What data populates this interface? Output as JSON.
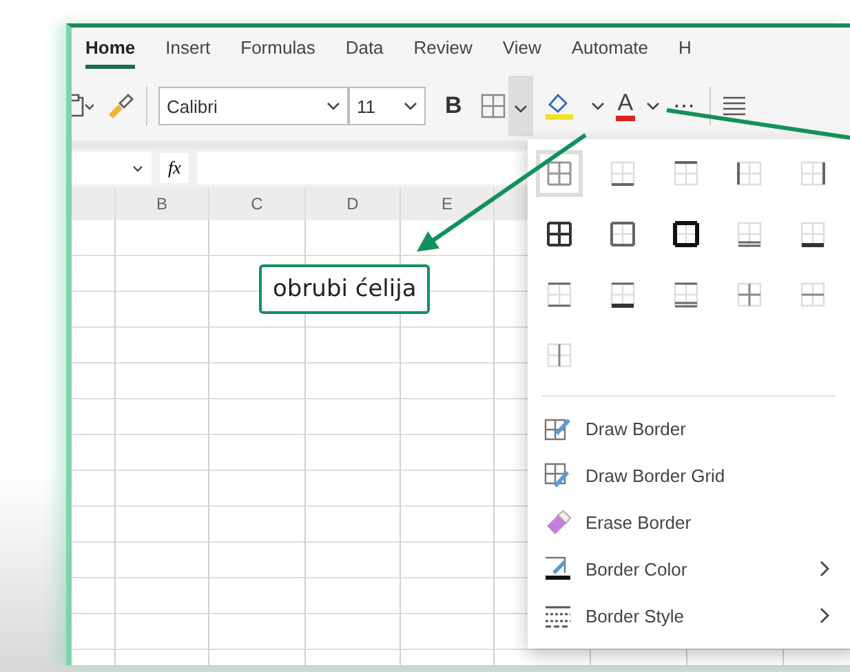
{
  "tabs": [
    {
      "label": "Home",
      "selected": true
    },
    {
      "label": "Insert",
      "selected": false
    },
    {
      "label": "Formulas",
      "selected": false
    },
    {
      "label": "Data",
      "selected": false
    },
    {
      "label": "Review",
      "selected": false
    },
    {
      "label": "View",
      "selected": false
    },
    {
      "label": "Automate",
      "selected": false
    },
    {
      "label": "H",
      "selected": false
    }
  ],
  "toolbar": {
    "font": "Calibri",
    "size": "11",
    "bold": "B",
    "font_color": "A",
    "more": "⋯",
    "borders_open": true
  },
  "formula_bar": {
    "fx": "fx"
  },
  "columns": [
    "B",
    "C",
    "D",
    "E"
  ],
  "annotation": "obrubi ćelija",
  "border_options": [
    {
      "kind": "all-light",
      "selected": true
    },
    {
      "kind": "bottom",
      "selected": false
    },
    {
      "kind": "top",
      "selected": false
    },
    {
      "kind": "left",
      "selected": false
    },
    {
      "kind": "right",
      "selected": false
    },
    {
      "kind": "all",
      "selected": false
    },
    {
      "kind": "outside",
      "selected": false
    },
    {
      "kind": "thick-outside",
      "selected": false
    },
    {
      "kind": "bottom-double",
      "selected": false
    },
    {
      "kind": "thick-bottom",
      "selected": false
    },
    {
      "kind": "top-bottom",
      "selected": false
    },
    {
      "kind": "top-thick-bottom",
      "selected": false
    },
    {
      "kind": "top-double-bottom",
      "selected": false
    },
    {
      "kind": "inside",
      "selected": false
    },
    {
      "kind": "inside-horizontal",
      "selected": false
    },
    {
      "kind": "inside-vertical",
      "selected": false
    }
  ],
  "menu_items": [
    {
      "kind": "draw",
      "label": "Draw Border",
      "submenu": false
    },
    {
      "kind": "grid",
      "label": "Draw Border Grid",
      "submenu": false
    },
    {
      "kind": "erase",
      "label": "Erase Border",
      "submenu": false
    },
    {
      "kind": "color",
      "label": "Border Color",
      "submenu": true
    },
    {
      "kind": "style",
      "label": "Border Style",
      "submenu": true
    }
  ]
}
